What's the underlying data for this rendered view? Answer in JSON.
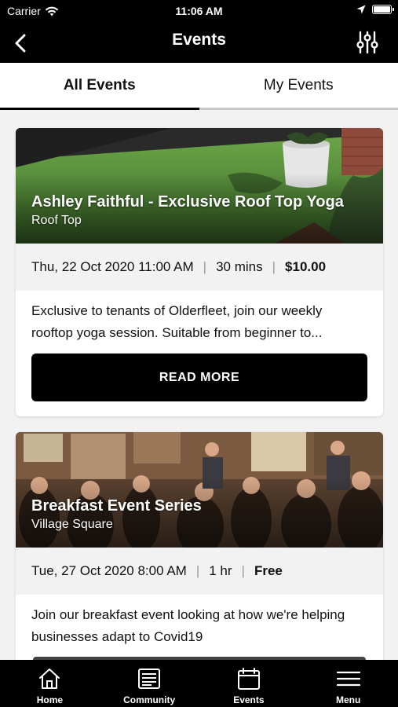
{
  "status_bar": {
    "carrier": "Carrier",
    "time": "11:06 AM"
  },
  "nav": {
    "title": "Events",
    "back_icon": "chevron-left-icon",
    "filter_icon": "sliders-icon"
  },
  "tabs": [
    {
      "label": "All Events",
      "active": true
    },
    {
      "label": "My Events",
      "active": false
    }
  ],
  "events": [
    {
      "title": "Ashley Faithful - Exclusive Roof Top Yoga",
      "location": "Roof Top",
      "datetime": "Thu, 22 Oct 2020 11:00 AM",
      "duration": "30 mins",
      "price": "$10.00",
      "description": "Exclusive to tenants of Olderfleet, join our weekly rooftop yoga session.  Suitable from beginner to...",
      "button_label": "READ MORE"
    },
    {
      "title": "Breakfast Event Series",
      "location": "Village Square",
      "datetime": "Tue, 27 Oct 2020 8:00 AM",
      "duration": "1 hr",
      "price": "Free",
      "description": "Join our breakfast event looking at how we're helping businesses adapt to Covid19"
    }
  ],
  "tab_bar": [
    {
      "label": "Home",
      "icon": "home-icon"
    },
    {
      "label": "Community",
      "icon": "community-icon"
    },
    {
      "label": "Events",
      "icon": "calendar-icon"
    },
    {
      "label": "Menu",
      "icon": "menu-icon"
    }
  ],
  "colors": {
    "header": "#000000",
    "background": "#f2f2f2",
    "button": "#000000"
  }
}
